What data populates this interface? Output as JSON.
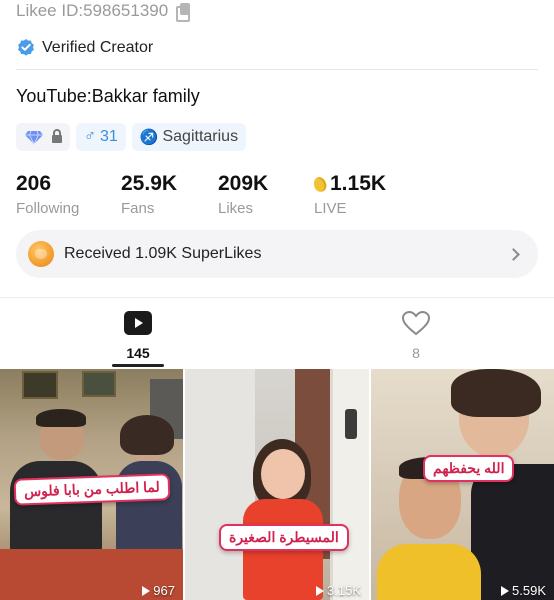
{
  "profile": {
    "likee_id": "Likee ID:598651390",
    "verified_label": "Verified Creator",
    "bio": "YouTube:Bakkar family"
  },
  "tags": {
    "gender_count": "31",
    "zodiac": "Sagittarius"
  },
  "stats": [
    {
      "value": "206",
      "label": "Following"
    },
    {
      "value": "25.9K",
      "label": "Fans"
    },
    {
      "value": "209K",
      "label": "Likes"
    },
    {
      "value": "1.15K",
      "label": "LIVE"
    }
  ],
  "superlikes": {
    "text": "Received 1.09K SuperLikes"
  },
  "tabs": {
    "videos_count": "145",
    "likes_count": "8"
  },
  "videos": [
    {
      "caption": "لما اطلب من بابا فلوس",
      "views": "967"
    },
    {
      "caption": "المسيطرة الصغيرة",
      "views": "3.15K"
    },
    {
      "caption": "الله يحفظهم",
      "views": "5.59K"
    }
  ],
  "colors": {
    "accent_blue": "#3c8fe0",
    "caption_red": "#d1224f"
  }
}
